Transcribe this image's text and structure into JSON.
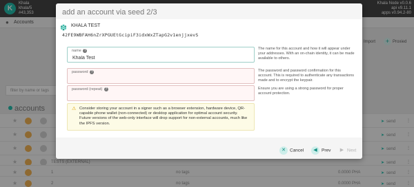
{
  "app": {
    "chain": {
      "name": "Khala",
      "account": "khala/5",
      "block": "#43,353"
    },
    "node": {
      "line1": "Khala Node v0.0.6",
      "line2": "api v9.11.1",
      "line3": "apps v0.94.2-80"
    },
    "tab_label": "Accounts",
    "import_label": "Import",
    "proxied_label": "Proxied",
    "filter_placeholder": "filter by name or tags",
    "accounts_heading": "accounts",
    "rows": [
      {
        "name": "",
        "tags": "",
        "balance": "",
        "send": "send",
        "more": "⋮"
      },
      {
        "name": "",
        "tags": "",
        "balance": "",
        "send": "send",
        "more": "⋮"
      },
      {
        "name": "",
        "tags": "",
        "balance": "",
        "send": "send",
        "more": "⋮"
      },
      {
        "name": "",
        "tags": "",
        "balance": "",
        "send": "send",
        "more": "⋮"
      },
      {
        "name": "TESTS (EXTERNAL)",
        "tags": "",
        "balance": "",
        "send": "send",
        "more": "⋮"
      },
      {
        "name": "1",
        "tags": "no tags",
        "balance": "0.0000 PHA",
        "send": "send",
        "more": "⋮"
      },
      {
        "name": "2",
        "tags": "no tags",
        "balance": "0.0000 PHA",
        "send": "send",
        "more": "⋮"
      }
    ]
  },
  "modal": {
    "title": "add an account via seed 2/3",
    "account_name": "KHALA TEST",
    "address": "42FE9WBFAH6nZrXPGUEtGcipiF3idxWxZTapG2v1enjjxevS",
    "fields": {
      "name": {
        "label": "name",
        "value": "Khala Test",
        "description": "The name for this account and how it will appear under your addresses. With an on-chain identity, it can be made available to others."
      },
      "password": {
        "label": "password",
        "value": "",
        "description": "The password and password confirmation for this account. This is required to authenticate any transactions made and to encrypt the keypair."
      },
      "password_repeat": {
        "label": "password (repeat)",
        "value": "",
        "description": "Ensure you are using a strong password for proper account protection."
      }
    },
    "warning": "Consider storing your account in a signer such as a browser extension, hardware device, QR-capable phone wallet (non-connected) or desktop application for optimal account security. Future versions of the web-only interface will drop support for non-external accounts, much like the IPFS version.",
    "buttons": {
      "cancel": "Cancel",
      "prev": "Prev",
      "next": "Next"
    }
  },
  "colors": {
    "accent": "#14b8a6",
    "warning_bg": "#fdfbe6",
    "error_bg": "#fff6f6"
  }
}
